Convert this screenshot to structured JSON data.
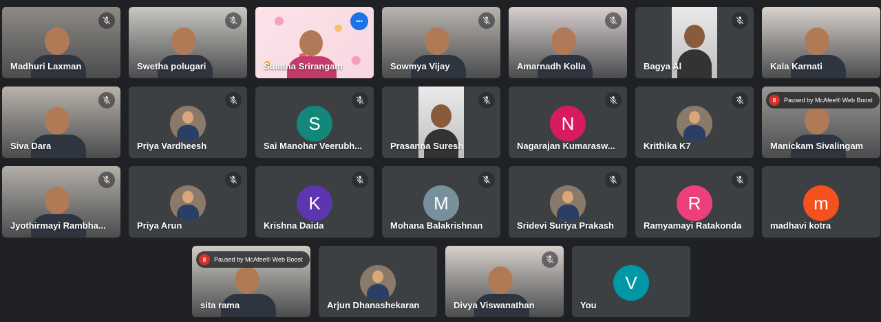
{
  "tiles": [
    {
      "name": "Madhuri Laxman",
      "type": "video",
      "bg": "#8f8a84",
      "mute": true
    },
    {
      "name": "Swetha polugari",
      "type": "video",
      "bg": "#c9c7c2",
      "mute": true
    },
    {
      "name": "Sulatha Srirangam",
      "type": "confetti",
      "mute": false,
      "more": true,
      "active": true
    },
    {
      "name": "Sowmya Vijay",
      "type": "video",
      "bg": "#b9b4ad",
      "mute": true
    },
    {
      "name": "Amarnadh Kolla",
      "type": "video",
      "bg": "#d8cfcf",
      "mute": true
    },
    {
      "name": "Bagya Al",
      "type": "inset",
      "mute": true
    },
    {
      "name": "Kala Karnati",
      "type": "video",
      "bg": "#d9d3cc",
      "mute": false
    },
    {
      "name": "Siva Dara",
      "type": "video",
      "bg": "#b8b2aa",
      "mute": true
    },
    {
      "name": "Priya Vardheesh",
      "type": "photo",
      "mute": true
    },
    {
      "name": "Sai Manohar Veerubh...",
      "type": "avatar",
      "letter": "S",
      "color": "#12877a",
      "mute": true
    },
    {
      "name": "Prasanna Suresh",
      "type": "inset",
      "mute": true
    },
    {
      "name": "Nagarajan Kumarasw...",
      "type": "avatar",
      "letter": "N",
      "color": "#d81b60",
      "mute": true
    },
    {
      "name": "Krithika K7",
      "type": "photo",
      "mute": true
    },
    {
      "name": "Manickam Sivalingam",
      "type": "video",
      "bg": "#9a9793",
      "mute": false,
      "paused": true
    },
    {
      "name": "Jyothirmayi Rambha...",
      "type": "video",
      "bg": "#b3aea8",
      "mute": true
    },
    {
      "name": "Priya Arun",
      "type": "photo",
      "mute": true
    },
    {
      "name": "Krishna Daida",
      "type": "avatar",
      "letter": "K",
      "color": "#5e35b1",
      "mute": true
    },
    {
      "name": "Mohana Balakrishnan",
      "type": "avatar",
      "letter": "M",
      "color": "#78909c",
      "mute": true
    },
    {
      "name": "Sridevi Suriya Prakash",
      "type": "photo",
      "mute": true
    },
    {
      "name": "Ramyamayi Ratakonda",
      "type": "avatar",
      "letter": "R",
      "color": "#ec407a",
      "mute": true
    },
    {
      "name": "madhavi kotra",
      "type": "avatar",
      "letter": "m",
      "color": "#f4511e",
      "mute": false
    },
    {
      "name": "sita rama",
      "type": "video",
      "bg": "#cfcac4",
      "mute": false,
      "paused": true
    },
    {
      "name": "Arjun Dhanashekaran",
      "type": "photo",
      "mute": false
    },
    {
      "name": "Divya Viswanathan",
      "type": "video",
      "bg": "#d6d1cb",
      "mute": true
    },
    {
      "name": "You",
      "type": "avatar",
      "letter": "V",
      "color": "#0097a7",
      "mute": false
    }
  ],
  "paused_label": "Paused by McAfee® Web Boost",
  "paused_icon": "pause-icon",
  "mute_icon": "mic-off-icon",
  "more_icon": "more-options-icon"
}
